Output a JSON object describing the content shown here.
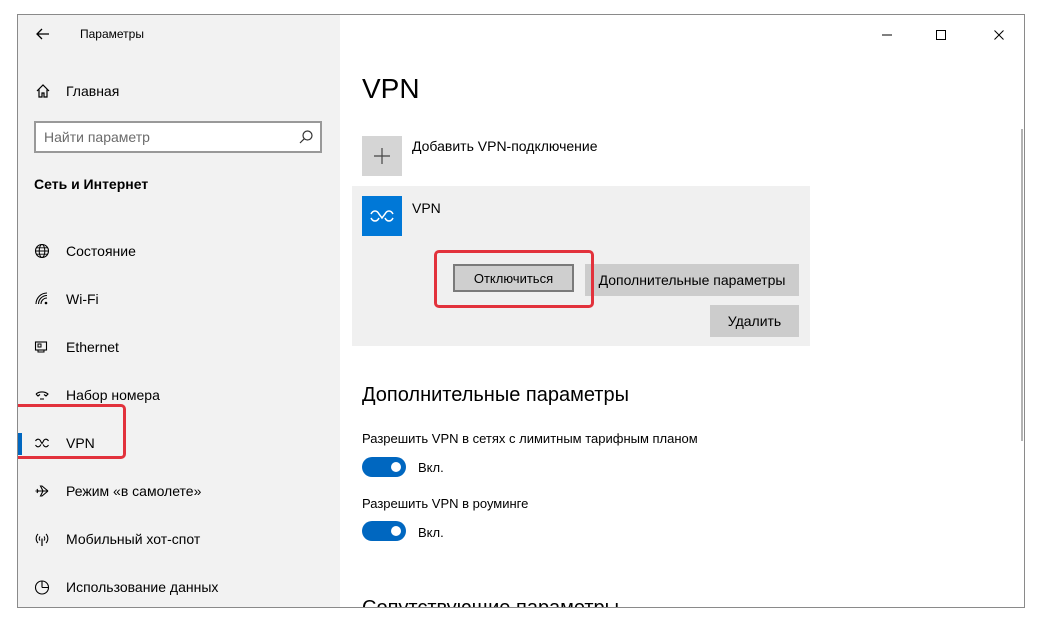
{
  "app": {
    "title": "Параметры"
  },
  "sidebar": {
    "home_label": "Главная",
    "search_placeholder": "Найти параметр",
    "section_title": "Сеть и Интернет",
    "items": [
      {
        "label": "Состояние",
        "icon": "globe-icon",
        "selected": false
      },
      {
        "label": "Wi-Fi",
        "icon": "wifi-icon",
        "selected": false
      },
      {
        "label": "Ethernet",
        "icon": "ethernet-icon",
        "selected": false
      },
      {
        "label": "Набор номера",
        "icon": "dialup-icon",
        "selected": false
      },
      {
        "label": "VPN",
        "icon": "vpn-icon",
        "selected": true
      },
      {
        "label": "Режим «в самолете»",
        "icon": "airplane-icon",
        "selected": false
      },
      {
        "label": "Мобильный хот-спот",
        "icon": "hotspot-icon",
        "selected": false
      },
      {
        "label": "Использование данных",
        "icon": "data-usage-icon",
        "selected": false
      }
    ]
  },
  "main": {
    "title": "VPN",
    "add_vpn_label": "Добавить VPN-подключение",
    "connection": {
      "name": "VPN",
      "disconnect_label": "Отключиться",
      "advanced_label": "Дополнительные параметры",
      "delete_label": "Удалить"
    },
    "advanced": {
      "title": "Дополнительные параметры",
      "options": [
        {
          "label": "Разрешить VPN в сетях с лимитным тарифным планом",
          "state_text": "Вкл.",
          "on": true
        },
        {
          "label": "Разрешить VPN в роуминге",
          "state_text": "Вкл.",
          "on": true
        }
      ]
    },
    "related_title_partial": "Сопутствующие параметры"
  },
  "colors": {
    "accent": "#0067c0",
    "vpn_tile": "#0078d7",
    "highlight": "#e2323c",
    "sidebar_bg": "#f2f2f2"
  }
}
